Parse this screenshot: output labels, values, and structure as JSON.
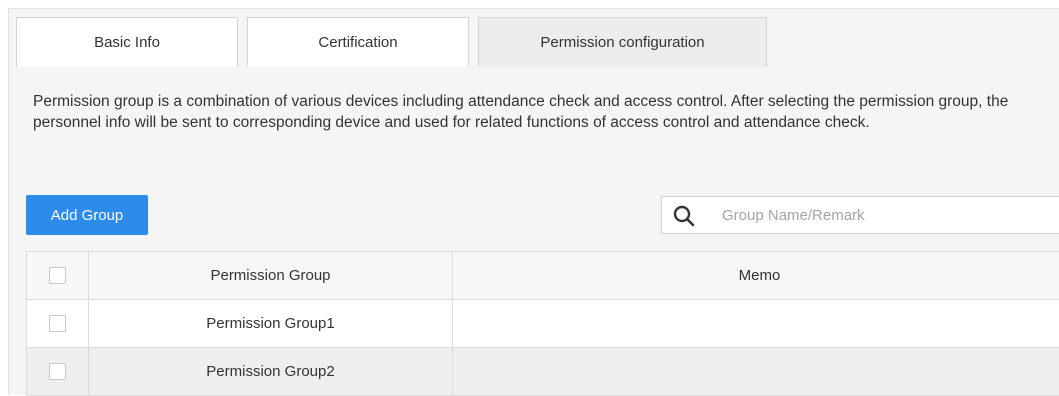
{
  "tabs": [
    {
      "label": "Basic Info",
      "active": false
    },
    {
      "label": "Certification",
      "active": false
    },
    {
      "label": "Permission configuration",
      "active": true
    }
  ],
  "description": "Permission group is a combination of various devices including attendance check and access control. After selecting the permission group, the personnel info will be sent to corresponding device and used for related functions of access control and attendance check.",
  "toolbar": {
    "add_group_label": "Add Group",
    "accent_color": "#2d8ce9"
  },
  "search": {
    "icon": "search-icon",
    "placeholder": "Group Name/Remark",
    "value": ""
  },
  "table": {
    "columns": [
      "",
      "Permission Group",
      "Memo"
    ],
    "rows": [
      {
        "checked": false,
        "group": "Permission Group1",
        "memo": ""
      },
      {
        "checked": false,
        "group": "Permission Group2",
        "memo": ""
      }
    ]
  }
}
